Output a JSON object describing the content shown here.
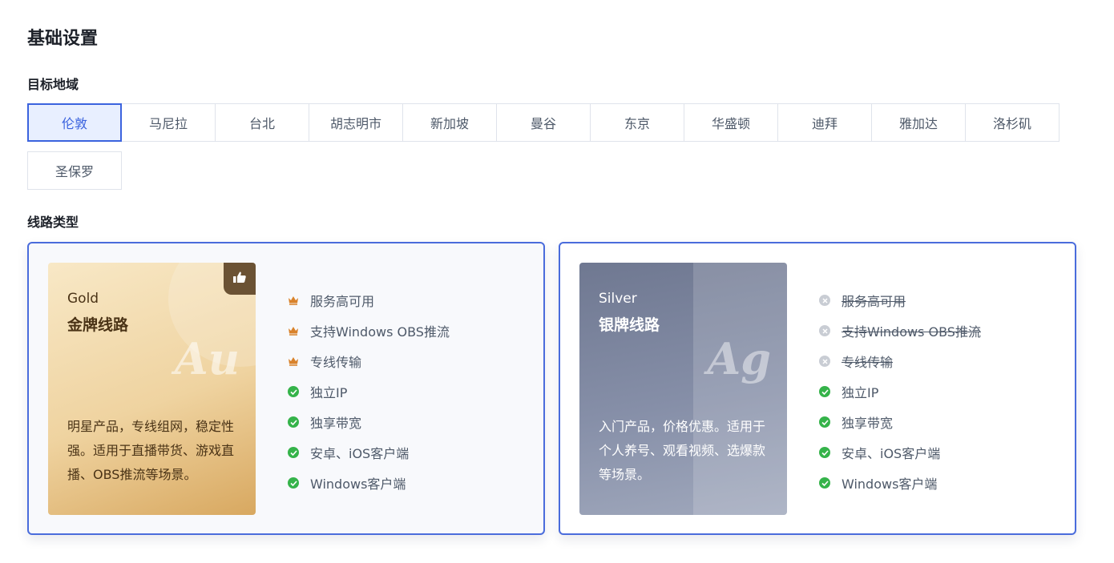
{
  "page": {
    "title": "基础设置"
  },
  "region_section": {
    "label": "目标地域",
    "selected": "伦敦",
    "regions": [
      "伦敦",
      "马尼拉",
      "台北",
      "胡志明市",
      "新加坡",
      "曼谷",
      "东京",
      "华盛顿",
      "迪拜",
      "雅加达",
      "洛杉矶",
      "圣保罗"
    ]
  },
  "line_section": {
    "label": "线路类型",
    "cards": [
      {
        "tier_en": "Gold",
        "tier_cn": "金牌线路",
        "symbol": "Au",
        "description": "明星产品，专线组网，稳定性强。适用于直播带货、游戏直播、OBS推流等场景。",
        "recommended_icon": "thumbs-up-icon",
        "features": [
          {
            "text": "服务高可用",
            "icon": "crown-icon"
          },
          {
            "text": "支持Windows OBS推流",
            "icon": "crown-icon"
          },
          {
            "text": "专线传输",
            "icon": "crown-icon"
          },
          {
            "text": "独立IP",
            "icon": "check-circle-icon"
          },
          {
            "text": "独享带宽",
            "icon": "check-circle-icon"
          },
          {
            "text": "安卓、iOS客户端",
            "icon": "check-circle-icon"
          },
          {
            "text": "Windows客户端",
            "icon": "check-circle-icon"
          }
        ]
      },
      {
        "tier_en": "Silver",
        "tier_cn": "银牌线路",
        "symbol": "Ag",
        "description": "入门产品，价格优惠。适用于个人养号、观看视频、选爆款等场景。",
        "features": [
          {
            "text": "服务高可用",
            "icon": "x-circle-icon",
            "unavailable": true
          },
          {
            "text": "支持Windows OBS推流",
            "icon": "x-circle-icon",
            "unavailable": true
          },
          {
            "text": "专线传输",
            "icon": "x-circle-icon",
            "unavailable": true
          },
          {
            "text": "独立IP",
            "icon": "check-circle-icon"
          },
          {
            "text": "独享带宽",
            "icon": "check-circle-icon"
          },
          {
            "text": "安卓、iOS客户端",
            "icon": "check-circle-icon"
          },
          {
            "text": "Windows客户端",
            "icon": "check-circle-icon"
          }
        ]
      }
    ]
  },
  "colors": {
    "accent": "#3b63de",
    "selected_bg": "#e8efff",
    "crown": "#d9822b",
    "check": "#35b34a",
    "x_gray": "#c9cdd4"
  }
}
